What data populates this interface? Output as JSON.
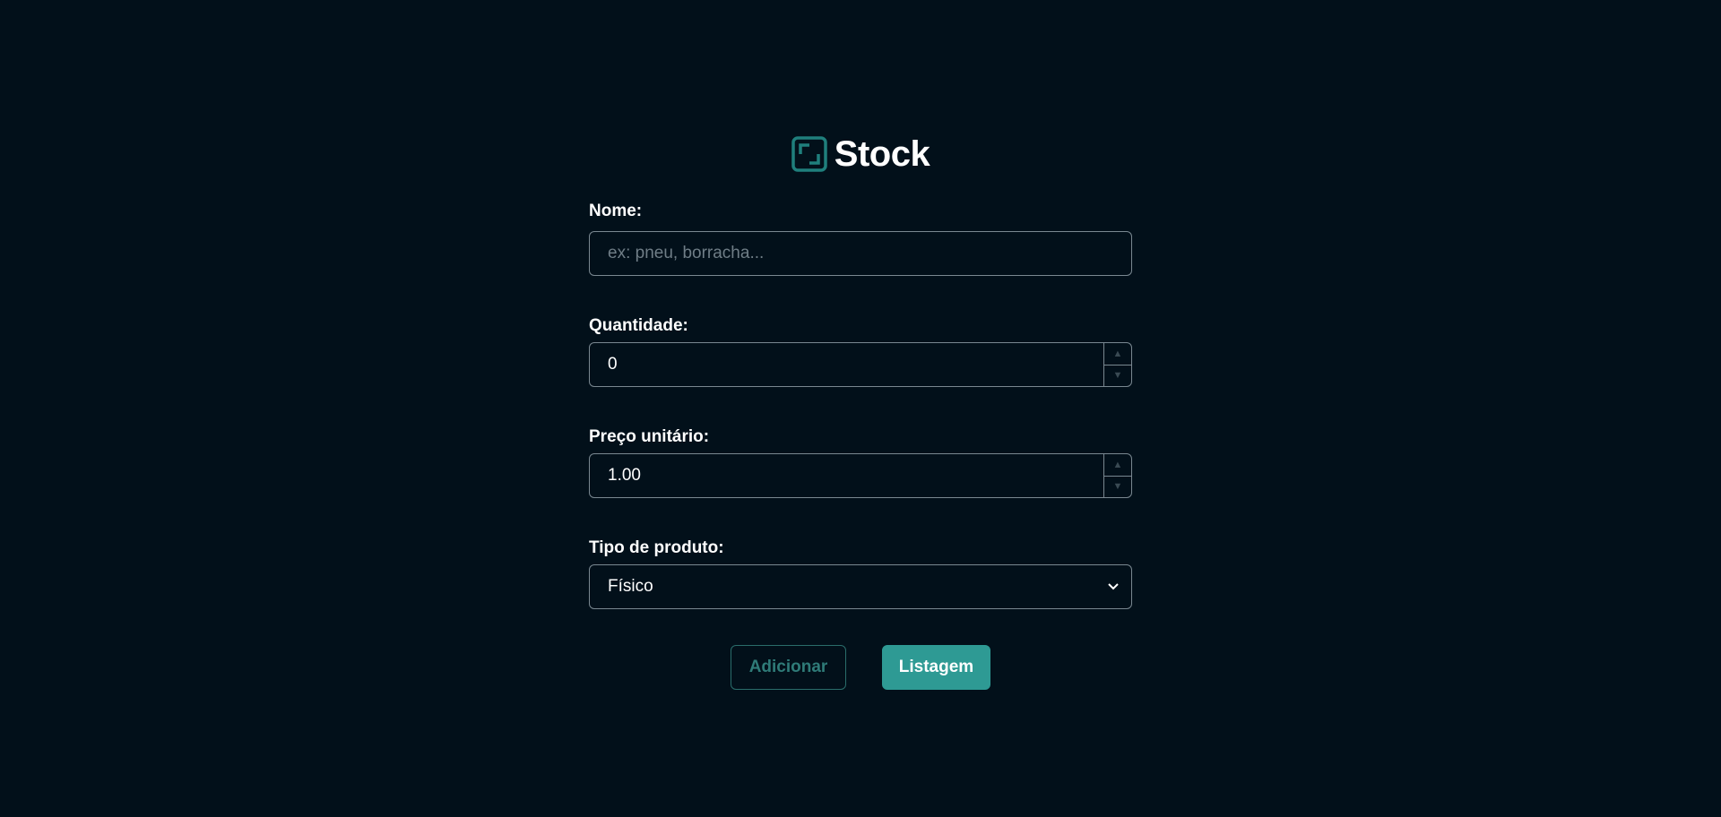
{
  "brand": {
    "name": "Stock",
    "logo_icon": "frame-corners-icon",
    "accent_color": "#2e9a94"
  },
  "form": {
    "nome": {
      "label": "Nome:",
      "placeholder": "ex: pneu, borracha..."
    },
    "quantidade": {
      "label": "Quantidade:",
      "value": "0"
    },
    "preco": {
      "label": "Preço unitário:",
      "value": "1.00"
    },
    "tipo": {
      "label": "Tipo de produto:",
      "selected": "Físico"
    }
  },
  "actions": {
    "adicionar_label": "Adicionar",
    "listagem_label": "Listagem"
  }
}
